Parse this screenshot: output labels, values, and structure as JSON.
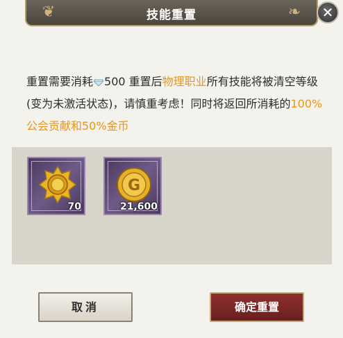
{
  "dialog": {
    "title": "技能重置",
    "message": {
      "part1": "重置需要消耗",
      "cost": "500",
      "part2": "重置后",
      "class_name": "物理职业",
      "part3": "所有技能将被清空等级(变为未激活状态)，请慎重考虑！同时将返回所消耗的",
      "refund": "100%公会贡献和50%金币"
    }
  },
  "rewards": [
    {
      "icon": "guild-medal-icon",
      "count": "70"
    },
    {
      "icon": "gold-coin-icon",
      "count": "21,600"
    }
  ],
  "buttons": {
    "cancel": "取消",
    "confirm": "确定重置"
  },
  "colors": {
    "highlight": "#e8951f",
    "confirm_button": "#7a2525",
    "panel": "#d7d5ca"
  }
}
